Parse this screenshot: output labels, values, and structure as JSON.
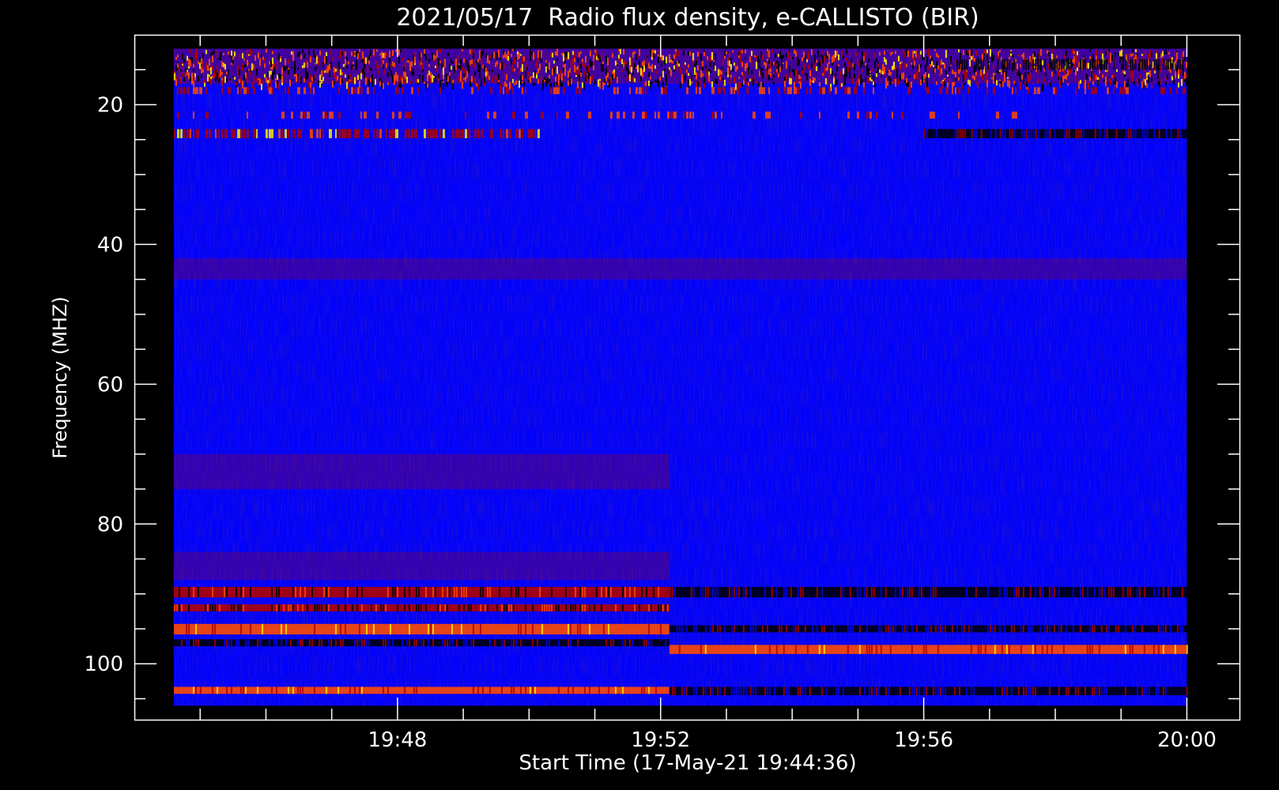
{
  "chart_data": {
    "type": "heatmap",
    "title": "2021/05/17  Radio flux density, e-CALLISTO (BIR)",
    "xlabel": "Start Time (17-May-21 19:44:36)",
    "ylabel": "Frequency (MHZ)",
    "x_range_minutes": [
      "19:44:36",
      "20:00:00"
    ],
    "xlim": [
      "19:44:00",
      "20:00:48"
    ],
    "ylim": [
      10,
      108
    ],
    "y_inverted": true,
    "x_ticks": [
      {
        "time": "19:48",
        "label": "19:48"
      },
      {
        "time": "19:52",
        "label": "19:52"
      },
      {
        "time": "19:56",
        "label": "19:56"
      },
      {
        "time": "20:00",
        "label": "20:00"
      }
    ],
    "y_ticks": [
      {
        "value": 20,
        "label": "20"
      },
      {
        "value": 40,
        "label": "40"
      },
      {
        "value": 60,
        "label": "60"
      },
      {
        "value": 80,
        "label": "80"
      },
      {
        "value": 100,
        "label": "100"
      }
    ],
    "data_freq_range": [
      12,
      106
    ],
    "segment_boundary_time": "19:52:08",
    "colors": {
      "background": "#0000ff",
      "low": "#000000",
      "mid": "#b00000",
      "high": "#ff4a00",
      "peak": "#ffee00"
    },
    "features": [
      {
        "freq_range": [
          12,
          17
        ],
        "time_range": [
          "19:44:36",
          "20:00:00"
        ],
        "intensity": "high",
        "pattern": "bursty"
      },
      {
        "freq_range": [
          17.5,
          18.5
        ],
        "time_range": [
          "19:44:36",
          "20:00:00"
        ],
        "intensity": "medium",
        "pattern": "dashed"
      },
      {
        "freq_range": [
          21,
          22
        ],
        "time_range": [
          "19:44:36",
          "19:57:30"
        ],
        "intensity": "low",
        "pattern": "dashed"
      },
      {
        "freq_range": [
          23.5,
          24.8
        ],
        "time_range": [
          "19:44:36",
          "19:50:15"
        ],
        "intensity": "high",
        "pattern": "dashed"
      },
      {
        "freq_range": [
          23.5,
          24.8
        ],
        "time_range": [
          "19:56:00",
          "20:00:00"
        ],
        "intensity": "dark",
        "pattern": "band"
      },
      {
        "freq_range": [
          42,
          45
        ],
        "time_range": [
          "19:44:36",
          "20:00:00"
        ],
        "intensity": "low",
        "pattern": "faint"
      },
      {
        "freq_range": [
          70,
          75
        ],
        "time_range": [
          "19:44:36",
          "19:52:08"
        ],
        "intensity": "low",
        "pattern": "faint"
      },
      {
        "freq_range": [
          84,
          88
        ],
        "time_range": [
          "19:44:36",
          "19:52:08"
        ],
        "intensity": "low",
        "pattern": "faint"
      },
      {
        "freq_range": [
          89,
          90.5
        ],
        "time_range": [
          "19:44:36",
          "19:52:08"
        ],
        "intensity": "medium",
        "pattern": "band"
      },
      {
        "freq_range": [
          91.5,
          92.5
        ],
        "time_range": [
          "19:44:36",
          "19:52:08"
        ],
        "intensity": "medium",
        "pattern": "band"
      },
      {
        "freq_range": [
          94.3,
          95.8
        ],
        "time_range": [
          "19:44:36",
          "19:52:08"
        ],
        "intensity": "high",
        "pattern": "band"
      },
      {
        "freq_range": [
          96.5,
          97.5
        ],
        "time_range": [
          "19:44:36",
          "19:52:08"
        ],
        "intensity": "dark",
        "pattern": "band"
      },
      {
        "freq_range": [
          103.3,
          104.3
        ],
        "time_range": [
          "19:44:36",
          "19:52:08"
        ],
        "intensity": "high",
        "pattern": "band"
      },
      {
        "freq_range": [
          89,
          90.5
        ],
        "time_range": [
          "19:52:08",
          "20:00:00"
        ],
        "intensity": "dark",
        "pattern": "band"
      },
      {
        "freq_range": [
          94.5,
          95.5
        ],
        "time_range": [
          "19:52:08",
          "20:00:00"
        ],
        "intensity": "dark",
        "pattern": "band"
      },
      {
        "freq_range": [
          97.3,
          98.6
        ],
        "time_range": [
          "19:52:08",
          "20:00:00"
        ],
        "intensity": "high",
        "pattern": "band"
      },
      {
        "freq_range": [
          103.3,
          104.5
        ],
        "time_range": [
          "19:52:08",
          "20:00:00"
        ],
        "intensity": "dark",
        "pattern": "band"
      }
    ]
  }
}
